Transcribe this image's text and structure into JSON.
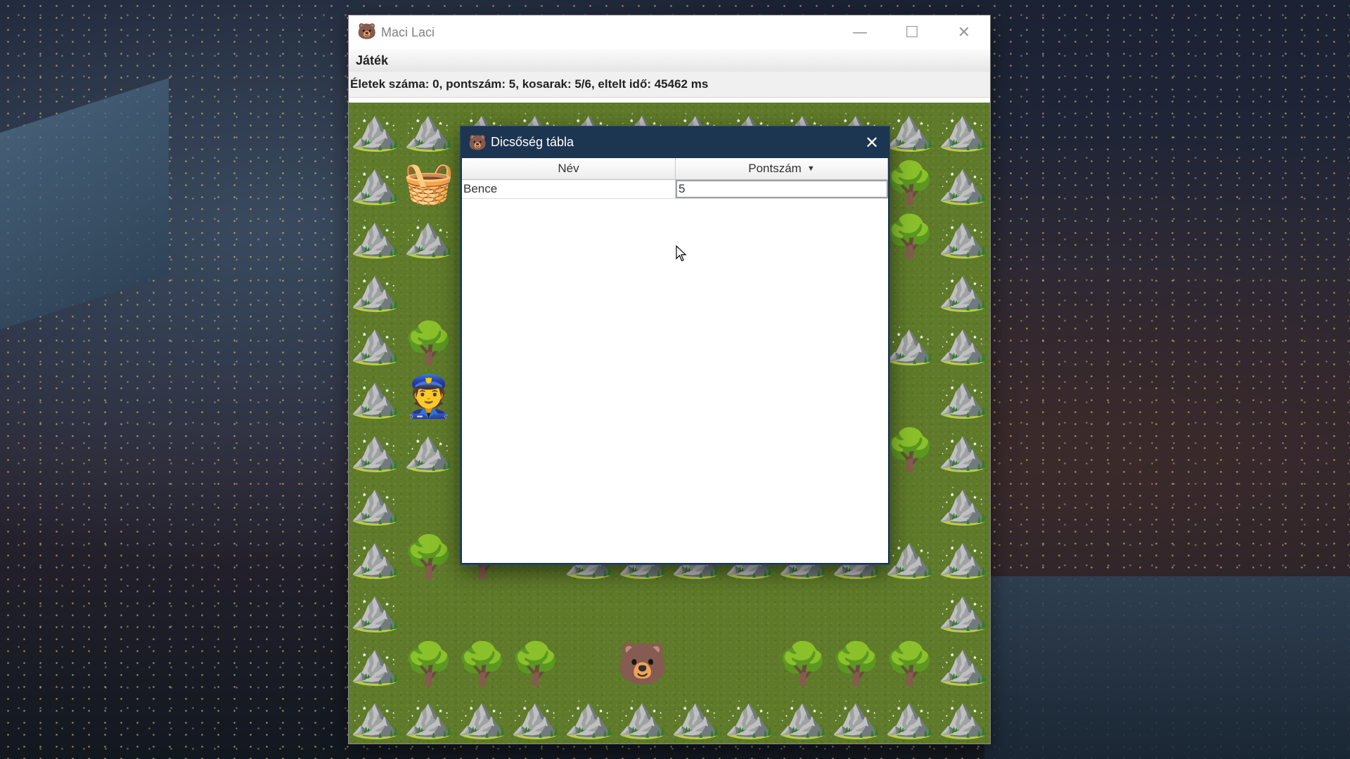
{
  "window": {
    "title": "Maci Laci",
    "app_icon": "bear-face-icon",
    "controls": {
      "minimize": "—",
      "maximize": "☐",
      "close": "✕"
    }
  },
  "menu": {
    "items": [
      "Játék"
    ]
  },
  "status": "Életek száma: 0, pontszám: 5, kosarak: 5/6, eltelt idő: 45462 ms",
  "board": {
    "cols": 12,
    "rows": 12,
    "legend": {
      "M": "⛰️",
      "T": "🌳",
      "B": "🧺",
      "P": "👮",
      "L": "🐻",
      ".": ""
    },
    "grid": [
      "MMMMMMMMMMMM",
      "MB........TM",
      "MM........TM",
      "M..........M",
      "MT........MM",
      "MP.........M",
      "MM........TM",
      "M..........M",
      "MTT.MMMMMMMM",
      "M..........M",
      "MTTT.L..TTTM",
      "MMMMMMMMMMMM"
    ]
  },
  "dialog": {
    "title": "Dicsőség tábla",
    "icon": "bear-face-icon",
    "close": "✕",
    "table": {
      "columns": [
        "Név",
        "Pontszám"
      ],
      "sort_indicator": "▼",
      "rows": [
        {
          "name": "Bence",
          "score": "5"
        }
      ]
    }
  }
}
